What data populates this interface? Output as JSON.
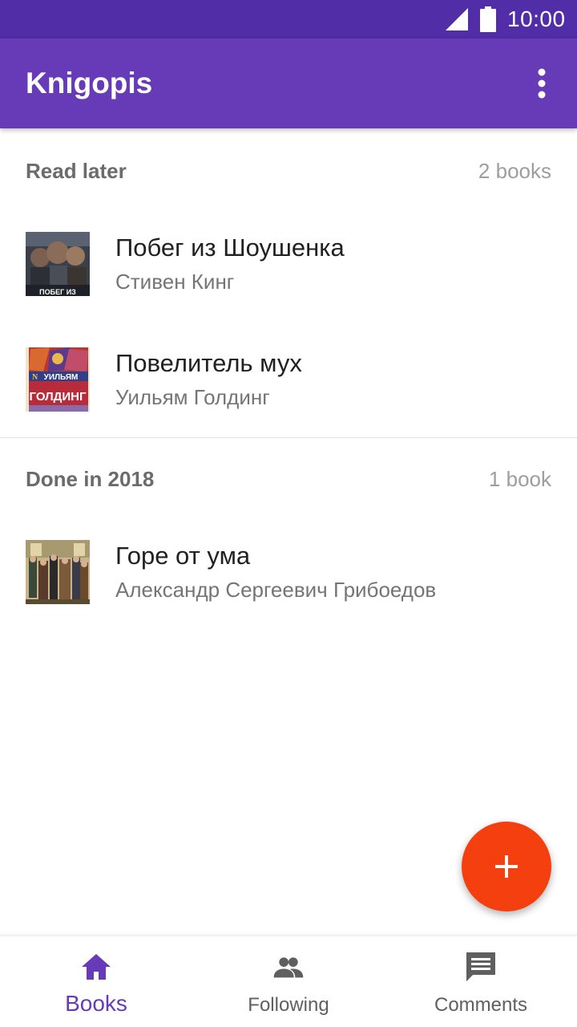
{
  "status_bar": {
    "time": "10:00",
    "icons": [
      "signal-icon",
      "battery-icon"
    ]
  },
  "app_bar": {
    "title": "Knigopis",
    "menu_icon": "more-vert-icon"
  },
  "sections": [
    {
      "name": "Read later",
      "count": "2 books",
      "books": [
        {
          "title": "Побег из Шоушенка",
          "author": "Стивен Кинг",
          "cover_text": "ПОБЕГ ИЗ"
        },
        {
          "title": "Повелитель мух",
          "author": "Уильям Голдинг",
          "cover_text_1": "УИЛЬЯМ",
          "cover_text_2": "ГОЛДИНГ"
        }
      ]
    },
    {
      "name": "Done in 2018",
      "count": "1 book",
      "books": [
        {
          "title": "Горе от ума",
          "author": "Александр Сергеевич Грибоедов"
        }
      ]
    }
  ],
  "fab": {
    "icon": "add-icon"
  },
  "bottom_nav": {
    "items": [
      {
        "label": "Books",
        "icon": "home-icon",
        "active": true
      },
      {
        "label": "Following",
        "icon": "people-icon",
        "active": false
      },
      {
        "label": "Comments",
        "icon": "comment-icon",
        "active": false
      }
    ]
  },
  "colors": {
    "status_bar": "#512da8",
    "primary": "#673ab7",
    "accent": "#f4400f",
    "inactive": "#5f5f5f"
  }
}
